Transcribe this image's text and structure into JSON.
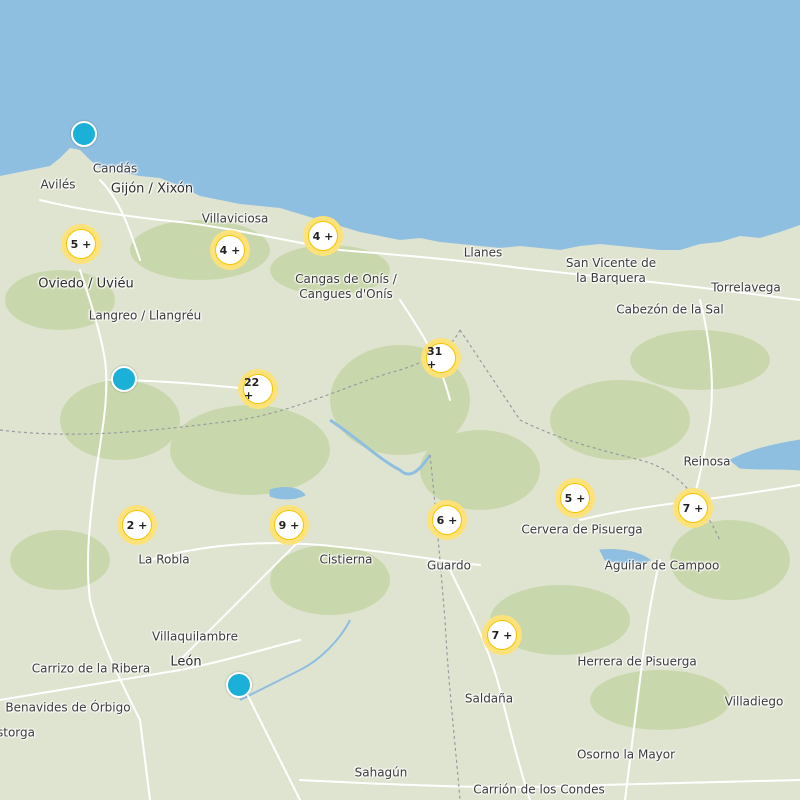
{
  "colors": {
    "sea": "#8fbfe0",
    "land": "#dfe4d0",
    "green": "#c2d3a5",
    "road": "#ffffff",
    "river": "#8fbfe0",
    "cluster_ring": "#fde27a",
    "cluster_border": "#f5c400",
    "marker": "#1bb0d8"
  },
  "places": [
    {
      "id": "candas",
      "label": "Candás"
    },
    {
      "id": "aviles",
      "label": "Avilés"
    },
    {
      "id": "gijon",
      "label": "Gijón / Xixón"
    },
    {
      "id": "villaviciosa",
      "label": "Villaviciosa"
    },
    {
      "id": "oviedo",
      "label": "Oviedo / Uviéu"
    },
    {
      "id": "langreo",
      "label": "Langreo / Llangréu"
    },
    {
      "id": "cangas",
      "label": "Cangas de Onís /\nCangues d'Onís"
    },
    {
      "id": "llanes",
      "label": "Llanes"
    },
    {
      "id": "sanvicente",
      "label": "San Vicente de\nla Barquera"
    },
    {
      "id": "torrelavega",
      "label": "Torrelavega"
    },
    {
      "id": "cabezon",
      "label": "Cabezón de la Sal"
    },
    {
      "id": "reinosa",
      "label": "Reinosa"
    },
    {
      "id": "cervera",
      "label": "Cervera de Pisuerga"
    },
    {
      "id": "aguilar",
      "label": "Aguilar de Campoo"
    },
    {
      "id": "larobla",
      "label": "La Robla"
    },
    {
      "id": "cistierna",
      "label": "Cistierna"
    },
    {
      "id": "guardo",
      "label": "Guardo"
    },
    {
      "id": "villaquilambre",
      "label": "Villaquilambre"
    },
    {
      "id": "leon",
      "label": "León"
    },
    {
      "id": "carrizo",
      "label": "Carrizo de la Ribera"
    },
    {
      "id": "herrera",
      "label": "Herrera de Pisuerga"
    },
    {
      "id": "saldana",
      "label": "Saldaña"
    },
    {
      "id": "benavides",
      "label": "Benavides de Órbigo"
    },
    {
      "id": "villadiego",
      "label": "Villadiego"
    },
    {
      "id": "astorga",
      "label": "storga"
    },
    {
      "id": "osorno",
      "label": "Osorno la Mayor"
    },
    {
      "id": "sahagun",
      "label": "Sahagún"
    },
    {
      "id": "carrion",
      "label": "Carrión de los Condes"
    }
  ],
  "clusters": [
    {
      "id": "c1",
      "label": "5 +"
    },
    {
      "id": "c2",
      "label": "4 +"
    },
    {
      "id": "c3",
      "label": "4 +"
    },
    {
      "id": "c4",
      "label": "31 +"
    },
    {
      "id": "c5",
      "label": "22 +"
    },
    {
      "id": "c6",
      "label": "2 +"
    },
    {
      "id": "c7",
      "label": "9 +"
    },
    {
      "id": "c8",
      "label": "6 +"
    },
    {
      "id": "c9",
      "label": "5 +"
    },
    {
      "id": "c10",
      "label": "7 +"
    },
    {
      "id": "c11",
      "label": "7 +"
    }
  ]
}
